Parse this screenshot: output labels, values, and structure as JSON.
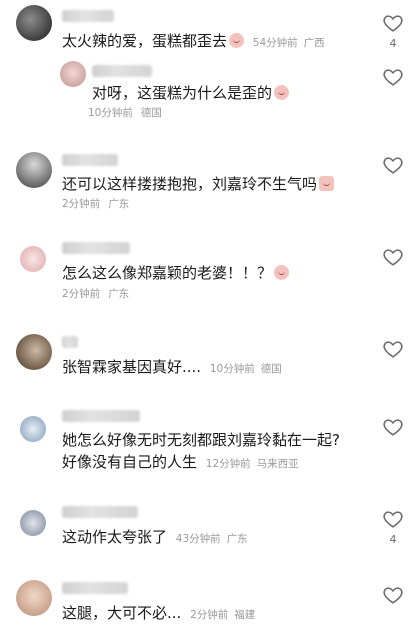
{
  "comments": [
    {
      "text": "太火辣的爱，蛋糕都歪去",
      "time": "54分钟前",
      "location": "广西",
      "likes": "4"
    },
    {
      "text": "对呀，这蛋糕为什么是歪的",
      "time": "10分钟前",
      "location": "德国",
      "likes": ""
    },
    {
      "text": "还可以这样搂搂抱抱，刘嘉玲不生气吗",
      "time": "2分钟前",
      "location": "广东",
      "likes": ""
    },
    {
      "text": "怎么这么像郑嘉颖的老婆！！？",
      "time": "2分钟前",
      "location": "广东",
      "likes": ""
    },
    {
      "text": "张智霖家基因真好....",
      "time": "10分钟前",
      "location": "德国",
      "likes": ""
    },
    {
      "text_line1": "她怎么好像无时无刻都跟刘嘉玲黏在一起?",
      "text_line2": "好像没有自己的人生",
      "time": "12分钟前",
      "location": "马来西亚",
      "likes": ""
    },
    {
      "text": "这动作太夸张了",
      "time": "43分钟前",
      "location": "广东",
      "likes": "4"
    },
    {
      "text": "这腿，大可不必...",
      "time": "2分钟前",
      "location": "福建",
      "likes": ""
    }
  ],
  "icons": {
    "like": "heart-outline-icon",
    "emoji": "face-emoji-icon"
  },
  "colors": {
    "text": "#1a1a1a",
    "meta": "#9a9a9a",
    "heart": "#6b6b6b",
    "background": "#ffffff"
  }
}
